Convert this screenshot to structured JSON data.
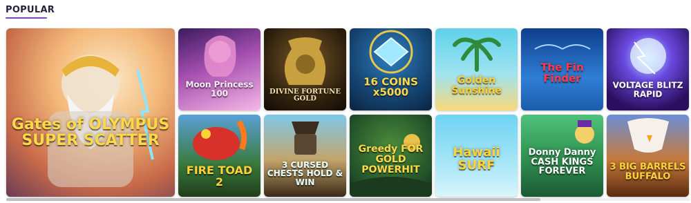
{
  "section": {
    "title": "POPULAR"
  },
  "games": [
    {
      "label": "Gates of OLYMPUS SUPER SCATTER"
    },
    {
      "label": "Moon Princess 100"
    },
    {
      "label": "DIVINE FORTUNE GOLD"
    },
    {
      "label": "16 COINS x5000"
    },
    {
      "label": "Golden Sunshine"
    },
    {
      "label": "The Fin Finder"
    },
    {
      "label": "VOLTAGE BLITZ RAPID"
    },
    {
      "label": "FIRE TOAD 2"
    },
    {
      "label": "3 CURSED CHESTS HOLD & WIN"
    },
    {
      "label": "Greedy FOR GOLD POWERHIT"
    },
    {
      "label": "Hawaii SURF"
    },
    {
      "label": "Donny Danny CASH KINGS FOREVER"
    },
    {
      "label": "3 BIG BARRELS BUFFALO"
    }
  ],
  "colors": {
    "accent": "#7b3fe4",
    "title": "#2a1f3d"
  }
}
